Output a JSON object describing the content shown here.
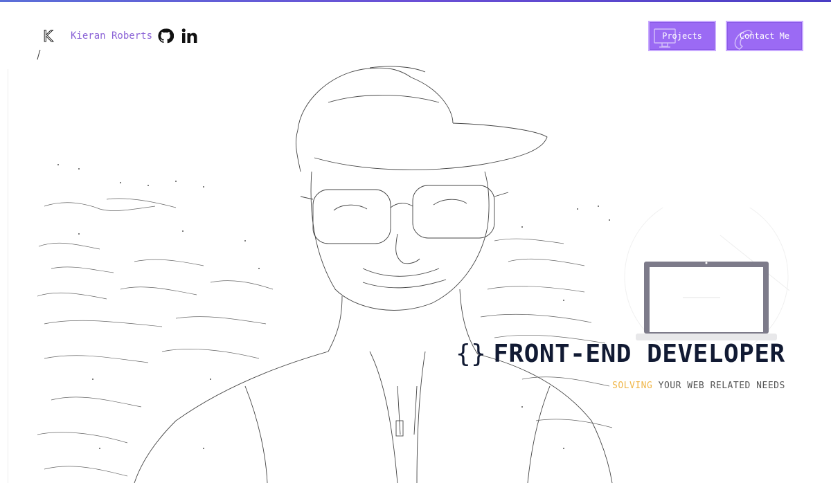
{
  "header": {
    "logo_letter": "K",
    "brand_name": "Kieran Roberts",
    "social": [
      {
        "icon": "github-icon"
      },
      {
        "icon": "linkedin-icon"
      }
    ],
    "nav": {
      "projects_label": "Projects",
      "contact_label": "Contact Me"
    }
  },
  "hero": {
    "braces": "{}",
    "title": "FRONT-END DEVELOPER",
    "subtitle_first_letter": "S",
    "subtitle_highlight": "OLVING",
    "subtitle_rest": " YOUR WEB RELATED NEEDS"
  },
  "colors": {
    "accent_purple": "#9b6af4",
    "brand_purple": "#8a62d6",
    "highlight_orange": "#f0b648",
    "title_navy": "#111a33",
    "top_bar": "#5b6fd8"
  }
}
